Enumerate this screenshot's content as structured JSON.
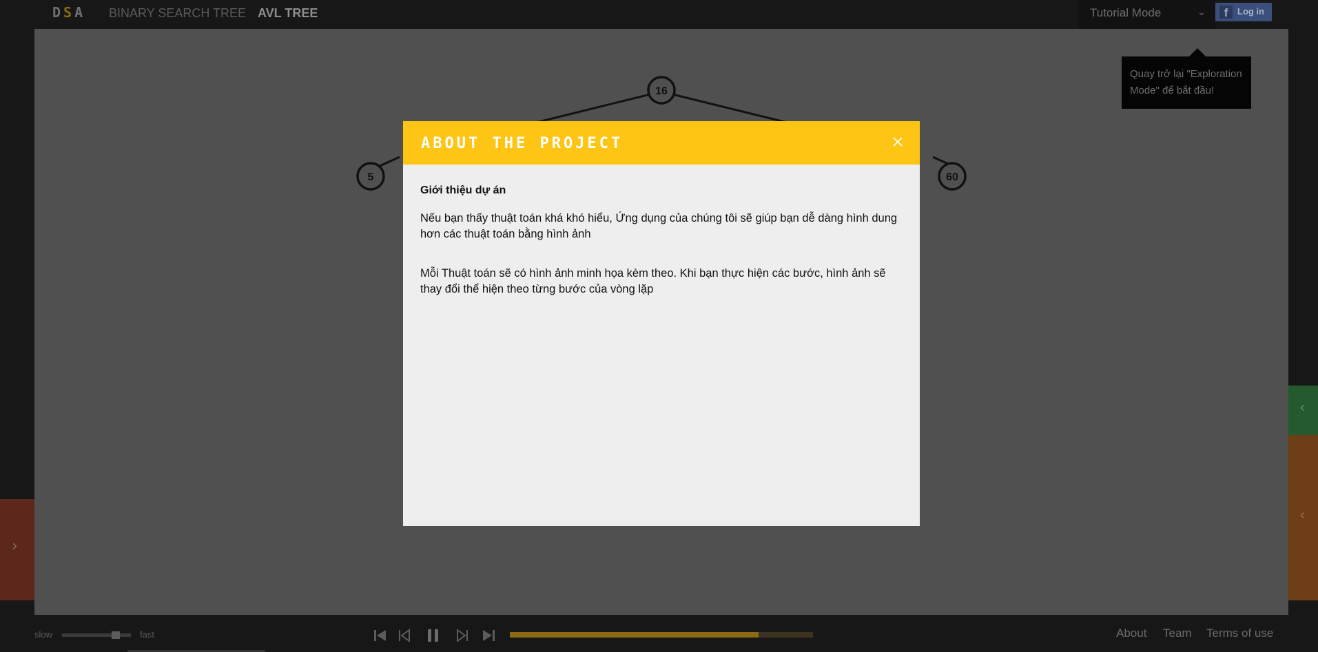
{
  "nav": {
    "logo": "DSA",
    "items": [
      {
        "label": "BINARY SEARCH TREE",
        "active": false
      },
      {
        "label": "AVL TREE",
        "active": true
      }
    ],
    "mode_select": {
      "value": "Tutorial Mode"
    },
    "login_button": "Log in"
  },
  "tooltip": {
    "text": "Quay trở lại \"Exploration Mode\" để bắt đầu!"
  },
  "tree": {
    "nodes": [
      {
        "id": "n16",
        "value": "16"
      },
      {
        "id": "n5",
        "value": "5"
      },
      {
        "id": "n60",
        "value": "60"
      }
    ]
  },
  "modal": {
    "title": "ABOUT THE PROJECT",
    "heading": "Giới thiệu dự án",
    "paragraph1": "Nếu bạn thấy thuật toán khá khó hiểu, Ứng dụng của chúng tôi sẽ giúp bạn dễ dàng hình dung hơn các thuật toán bằng hình ảnh",
    "paragraph2": "Mỗi Thuật toán sẽ có hình ảnh minh họa kèm theo. Khi bạn thực hiện các bước, hình ảnh sẽ thay đổi thể hiện theo từng bước của vòng lặp"
  },
  "playback": {
    "speed_slow_label": "slow",
    "speed_fast_label": "fast",
    "speed_level": 0.72,
    "progress": 0.82,
    "icons": [
      "skip-start-icon",
      "step-back-icon",
      "pause-icon",
      "step-forward-icon",
      "skip-end-icon"
    ]
  },
  "footer": {
    "links": [
      "About",
      "Team",
      "Terms of use"
    ]
  },
  "colors": {
    "accent": "#fec515",
    "modal_bg": "#eeeeee",
    "canvas_dim": "#505050",
    "side_left": "#5c281c",
    "side_green": "#245a2d",
    "side_orange": "#6e3e16"
  }
}
